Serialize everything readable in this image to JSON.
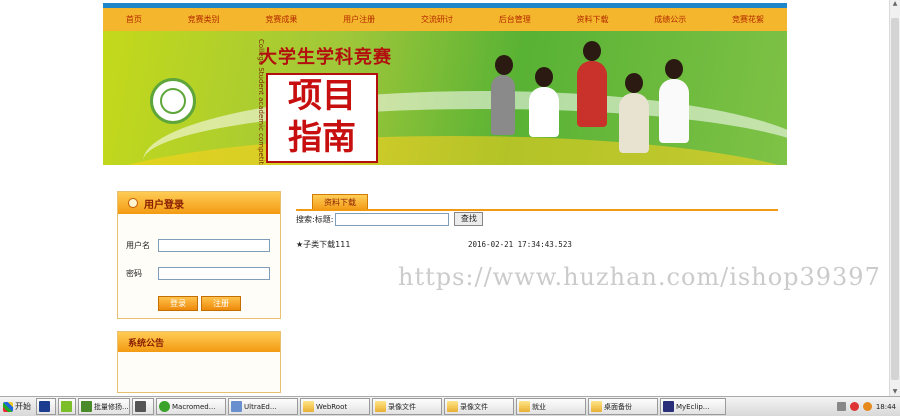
{
  "nav": [
    "首页",
    "竞赛类别",
    "竞赛成果",
    "用户注册",
    "交流研讨",
    "后台管理",
    "资料下载",
    "成绩公示",
    "竞赛花絮"
  ],
  "banner": {
    "title": "大学生学科竞赛",
    "english": "College Student academic competition Project Guide",
    "big_line1": "项目",
    "big_line2": "指南"
  },
  "login": {
    "header": "用户登录",
    "username_label": "用户名",
    "password_label": "密码",
    "username_value": "",
    "password_value": "",
    "login_button": "登录",
    "register_button": "注册"
  },
  "notice": {
    "header": "系统公告"
  },
  "content": {
    "tab_label": "资料下载",
    "search_label": "搜索:标题:",
    "search_value": "",
    "search_button": "查找",
    "items": [
      {
        "title": "★子类下载111",
        "date": "2016-02-21 17:34:43.523"
      }
    ]
  },
  "watermark": "https://www.huzhan.com/ishop39397",
  "taskbar": {
    "start": "开始",
    "items": [
      "",
      "",
      "批量修扬...",
      "",
      "Macromed...",
      "UltraEd...",
      "WebRoot",
      "录像文件",
      "录像文件",
      "就业",
      "桌面备份",
      "MyEclip..."
    ],
    "clock": "18:44"
  },
  "colors": {
    "nav_top": "#1f86c9",
    "nav_bar": "#f4b62c",
    "accent": "#f29a14",
    "text_red": "#b40f0f"
  }
}
